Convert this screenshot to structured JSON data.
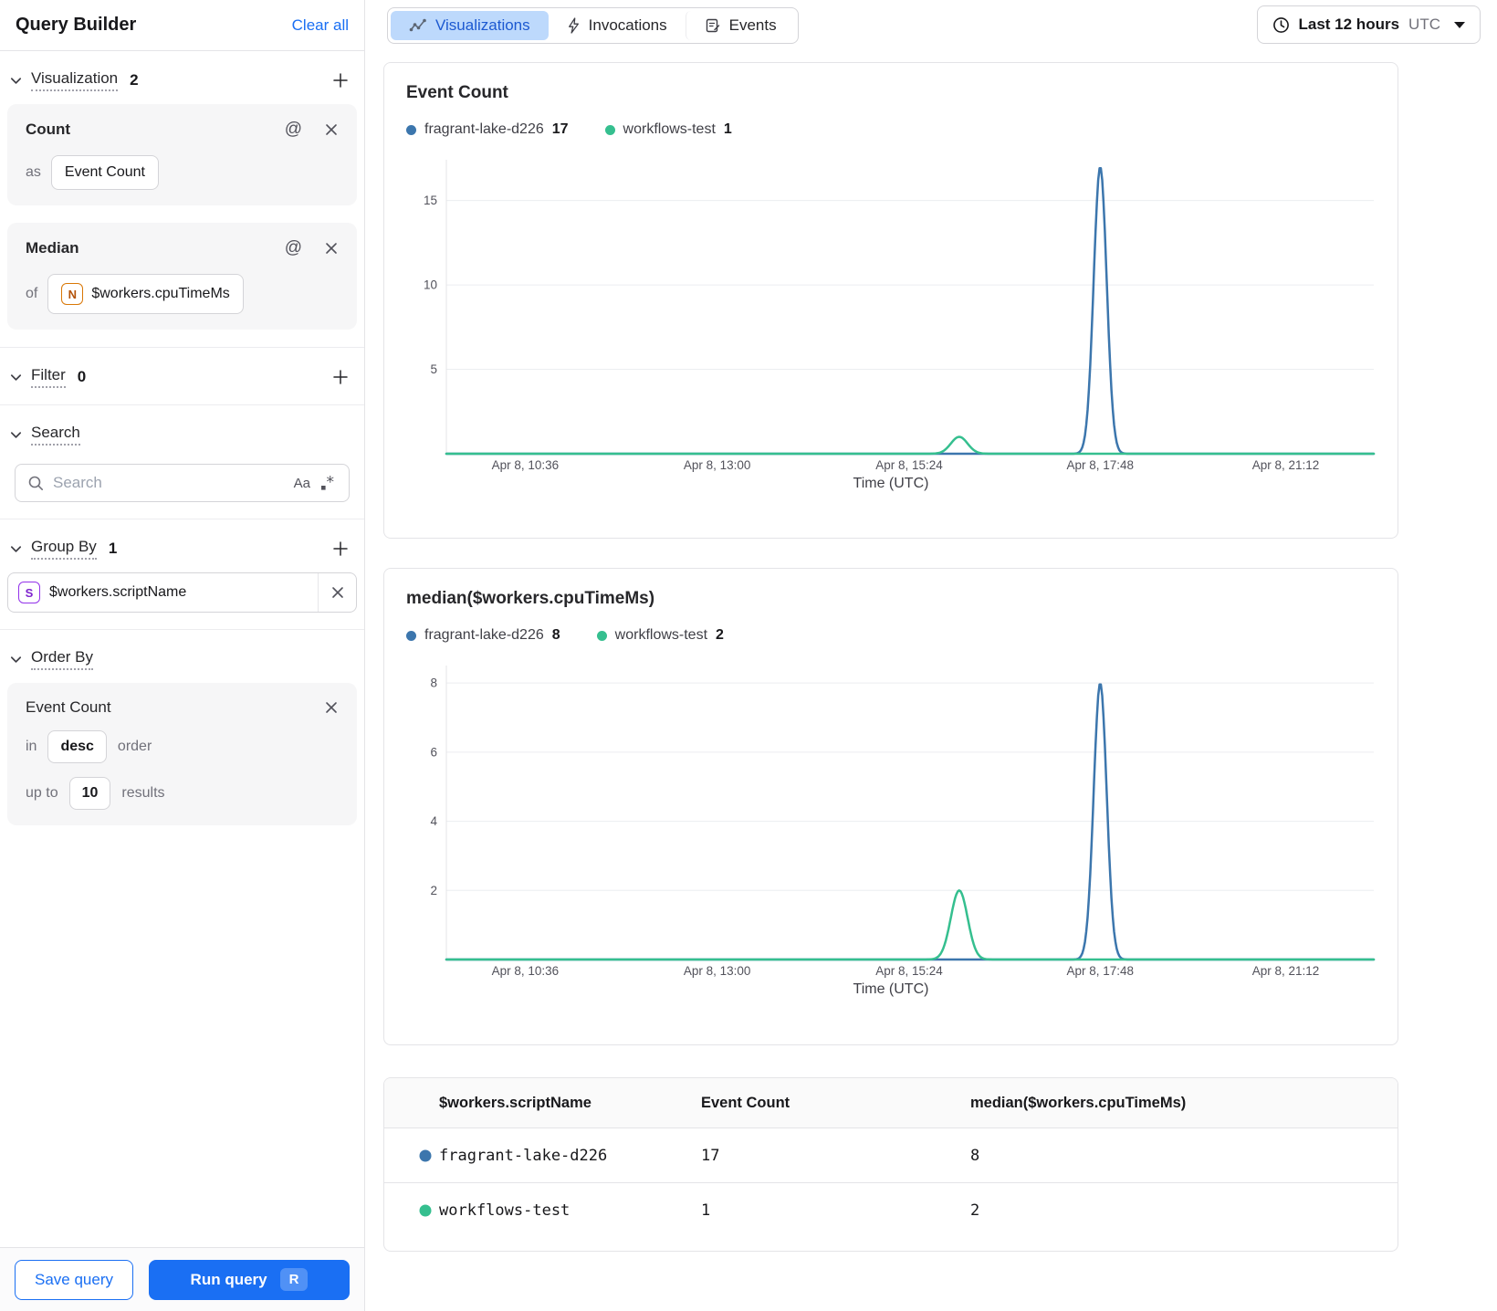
{
  "app": {
    "title": "Query Builder",
    "clear_all": "Clear all"
  },
  "topbar": {
    "tabs": [
      {
        "label": "Visualizations",
        "active": true
      },
      {
        "label": "Invocations",
        "active": false
      },
      {
        "label": "Events",
        "active": false
      }
    ],
    "time_range": {
      "label": "Last 12 hours",
      "timezone": "UTC"
    }
  },
  "sidebar": {
    "visualization": {
      "label": "Visualization",
      "count": "2"
    },
    "cards": [
      {
        "title": "Count",
        "prefix": "as",
        "value": "Event Count"
      },
      {
        "title": "Median",
        "prefix": "of",
        "value": "$workers.cpuTimeMs",
        "type_letter": "N"
      }
    ],
    "filter": {
      "label": "Filter",
      "count": "0"
    },
    "search": {
      "label": "Search",
      "placeholder": "Search",
      "match_case": "Aa"
    },
    "group_by": {
      "label": "Group By",
      "count": "1",
      "item": {
        "value": "$workers.scriptName",
        "type_letter": "S"
      }
    },
    "order_by": {
      "label": "Order By",
      "field": "Event Count",
      "in_label": "in",
      "direction": "desc",
      "order_label": "order",
      "up_to_label": "up to",
      "limit": "10",
      "results_label": "results"
    },
    "footer": {
      "save": "Save query",
      "run": "Run query",
      "shortcut": "R"
    }
  },
  "colors": {
    "series_blue": "#3c76ad",
    "series_green": "#35bf8f",
    "accent_blue": "#1a6ff3",
    "active_tab_bg": "#bdd9fc",
    "active_tab_text": "#1c59d1"
  },
  "chart_data": [
    {
      "type": "line",
      "title": "Event Count",
      "xlabel": "Time (UTC)",
      "legend": [
        {
          "name": "fragrant-lake-d226",
          "value": "17",
          "color": "#3c76ad"
        },
        {
          "name": "workflows-test",
          "value": "1",
          "color": "#35bf8f"
        }
      ],
      "x_ticks": [
        {
          "label": "Apr 8, 10:36",
          "pos": 0.085
        },
        {
          "label": "Apr 8, 13:00",
          "pos": 0.292
        },
        {
          "label": "Apr 8, 15:24",
          "pos": 0.499
        },
        {
          "label": "Apr 8, 17:48",
          "pos": 0.705
        },
        {
          "label": "Apr 8, 21:12",
          "pos": 0.905
        }
      ],
      "y_ticks": [
        5,
        10,
        15
      ],
      "y_max": 17.2,
      "grid": true,
      "legend_position": "top",
      "series": [
        {
          "name": "fragrant-lake-d226",
          "color": "#3c76ad",
          "baseline": 0,
          "spikes": [
            {
              "center_pos": 0.705,
              "center_time": "Apr 8, ~17:48",
              "peak": 17,
              "width": 0.007
            }
          ]
        },
        {
          "name": "workflows-test",
          "color": "#35bf8f",
          "baseline": 0,
          "spikes": [
            {
              "center_pos": 0.553,
              "center_time": "Apr 8, ~15:45",
              "peak": 1,
              "width": 0.009
            }
          ]
        }
      ]
    },
    {
      "type": "line",
      "title": "median($workers.cpuTimeMs)",
      "xlabel": "Time (UTC)",
      "legend": [
        {
          "name": "fragrant-lake-d226",
          "value": "8",
          "color": "#3c76ad"
        },
        {
          "name": "workflows-test",
          "value": "2",
          "color": "#35bf8f"
        }
      ],
      "x_ticks": [
        {
          "label": "Apr 8, 10:36",
          "pos": 0.085
        },
        {
          "label": "Apr 8, 13:00",
          "pos": 0.292
        },
        {
          "label": "Apr 8, 15:24",
          "pos": 0.499
        },
        {
          "label": "Apr 8, 17:48",
          "pos": 0.705
        },
        {
          "label": "Apr 8, 21:12",
          "pos": 0.905
        }
      ],
      "y_ticks": [
        2,
        4,
        6,
        8
      ],
      "y_max": 8.4,
      "grid": true,
      "legend_position": "top",
      "series": [
        {
          "name": "fragrant-lake-d226",
          "color": "#3c76ad",
          "baseline": 0,
          "spikes": [
            {
              "center_pos": 0.705,
              "center_time": "Apr 8, ~17:48",
              "peak": 8,
              "width": 0.007
            }
          ]
        },
        {
          "name": "workflows-test",
          "color": "#35bf8f",
          "baseline": 0,
          "spikes": [
            {
              "center_pos": 0.553,
              "center_time": "Apr 8, ~15:45",
              "peak": 2,
              "width": 0.009
            }
          ]
        }
      ]
    }
  ],
  "table": {
    "columns": [
      "$workers.scriptName",
      "Event Count",
      "median($workers.cpuTimeMs)"
    ],
    "rows": [
      {
        "color": "#3c76ad",
        "name": "fragrant-lake-d226",
        "event_count": "17",
        "median": "8"
      },
      {
        "color": "#35bf8f",
        "name": "workflows-test",
        "event_count": "1",
        "median": "2"
      }
    ]
  }
}
